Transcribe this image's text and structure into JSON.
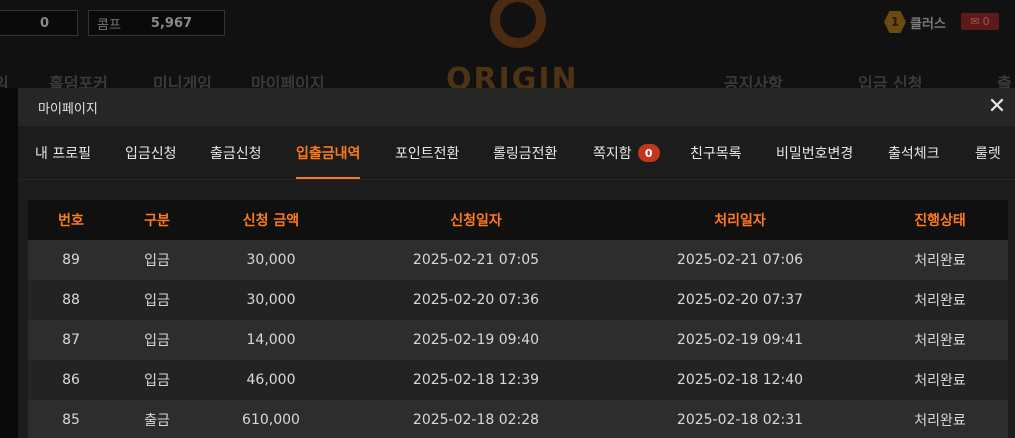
{
  "header": {
    "left_box_value": "0",
    "right_box_label": "콤프",
    "right_box_value": "5,967",
    "logo_text": "ORIGIN",
    "rank_number": "1",
    "rank_name": "클러스",
    "mail_count": "0",
    "nav": [
      "임",
      "홀덤포커",
      "미니게임",
      "마이페이지",
      "공지사항",
      "입금 신청",
      "출"
    ]
  },
  "modal": {
    "title": "마이페이지",
    "tabs": [
      {
        "label": "내 프로필"
      },
      {
        "label": "입금신청"
      },
      {
        "label": "출금신청"
      },
      {
        "label": "입출금내역",
        "active": true
      },
      {
        "label": "포인트전환"
      },
      {
        "label": "롤링금전환"
      },
      {
        "label": "쪽지함",
        "badge": "0"
      },
      {
        "label": "친구목록"
      },
      {
        "label": "비밀번호변경"
      },
      {
        "label": "출석체크"
      },
      {
        "label": "룰렛"
      }
    ],
    "table": {
      "columns": [
        "번호",
        "구분",
        "신청 금액",
        "신청일자",
        "처리일자",
        "진행상태"
      ],
      "rows": [
        [
          "89",
          "입금",
          "30,000",
          "2025-02-21 07:05",
          "2025-02-21 07:06",
          "처리완료"
        ],
        [
          "88",
          "입금",
          "30,000",
          "2025-02-20 07:36",
          "2025-02-20 07:37",
          "처리완료"
        ],
        [
          "87",
          "입금",
          "14,000",
          "2025-02-19 09:40",
          "2025-02-19 09:41",
          "처리완료"
        ],
        [
          "86",
          "입금",
          "46,000",
          "2025-02-18 12:39",
          "2025-02-18 12:40",
          "처리완료"
        ],
        [
          "85",
          "출금",
          "610,000",
          "2025-02-18 02:28",
          "2025-02-18 02:31",
          "처리완료"
        ]
      ]
    }
  },
  "colors": {
    "accent": "#ff7a1a",
    "badge": "#c4361c",
    "modal_bg": "#1c1c1c",
    "header_row_bg": "#101010"
  }
}
